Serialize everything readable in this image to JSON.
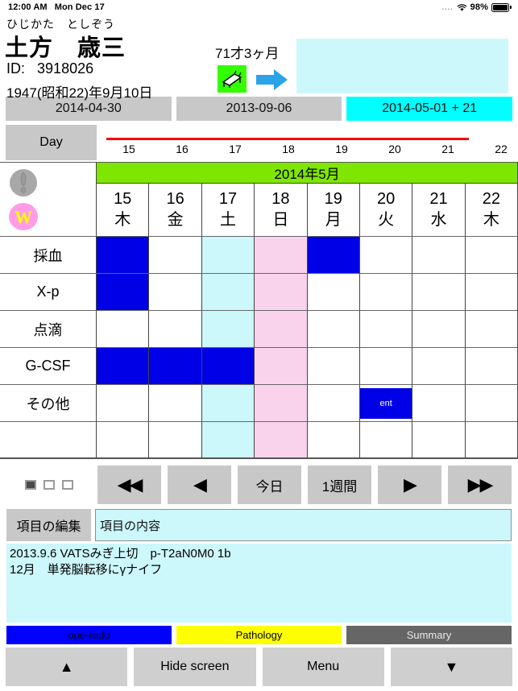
{
  "statusbar": {
    "time": "12:00 AM",
    "date": "Mon Dec 17",
    "dots": "....",
    "battery": "98%",
    "wifi_icon": "wifi-icon",
    "battery_icon": "battery-icon"
  },
  "patient": {
    "kana": "ひじかた　としぞう",
    "name": "土方　歳三",
    "id_label": "ID:",
    "id_value": "3918026",
    "birthdate": "1947(昭和22)年9月10日",
    "age": "71才3ヶ月",
    "bed_icon": "bed-icon",
    "arrow_icon": "arrow-right-icon",
    "memo": ""
  },
  "date_buttons": [
    {
      "label": "2014-04-30",
      "active": false
    },
    {
      "label": "2013-09-06",
      "active": false
    },
    {
      "label": "2014-05-01 + 21",
      "active": true
    }
  ],
  "ruler": {
    "day_button": "Day",
    "ticks": [
      "15",
      "16",
      "17",
      "18",
      "19",
      "20",
      "21",
      "22"
    ],
    "flag_icon": "flag-icon"
  },
  "calendar": {
    "month_label": "2014年5月",
    "status_icon_1": "warning-circle-icon",
    "status_icon_2": "w-badge-icon",
    "columns": [
      {
        "day": "15",
        "weekday": "木",
        "type": "weekday"
      },
      {
        "day": "16",
        "weekday": "金",
        "type": "weekday"
      },
      {
        "day": "17",
        "weekday": "土",
        "type": "sat"
      },
      {
        "day": "18",
        "weekday": "日",
        "type": "sun"
      },
      {
        "day": "19",
        "weekday": "月",
        "type": "weekday"
      },
      {
        "day": "20",
        "weekday": "火",
        "type": "weekday"
      },
      {
        "day": "21",
        "weekday": "水",
        "type": "weekday"
      },
      {
        "day": "22",
        "weekday": "木",
        "type": "weekday"
      }
    ],
    "rows": [
      {
        "label": "採血",
        "cells": [
          {
            "mark": true
          },
          {},
          {},
          {},
          {
            "mark": true
          },
          {},
          {},
          {}
        ]
      },
      {
        "label": "X-p",
        "cells": [
          {
            "mark": true
          },
          {},
          {},
          {},
          {},
          {},
          {},
          {}
        ]
      },
      {
        "label": "点滴",
        "cells": [
          {},
          {},
          {},
          {},
          {},
          {},
          {},
          {}
        ]
      },
      {
        "label": "G-CSF",
        "cells": [
          {
            "mark": true
          },
          {
            "mark": true
          },
          {
            "mark": true
          },
          {},
          {},
          {},
          {},
          {}
        ]
      },
      {
        "label": "その他",
        "cells": [
          {},
          {},
          {},
          {},
          {},
          {
            "chip": "ent"
          },
          {},
          {}
        ]
      },
      {
        "label": "",
        "cells": [
          {},
          {},
          {},
          {},
          {},
          {},
          {},
          {}
        ]
      }
    ]
  },
  "nav": {
    "indicators": [
      true,
      false,
      false
    ],
    "buttons": [
      {
        "name": "rewind",
        "glyph": "◀◀"
      },
      {
        "name": "prev",
        "glyph": "◀"
      },
      {
        "name": "today",
        "glyph": "今日"
      },
      {
        "name": "one-week",
        "glyph": "1週間"
      },
      {
        "name": "next",
        "glyph": "▶"
      },
      {
        "name": "fast-forward",
        "glyph": "▶▶"
      }
    ]
  },
  "item_edit": {
    "button_label": "項目の編集",
    "field_placeholder": "項目の内容",
    "field_value": ""
  },
  "notes": {
    "text": "2013.9.6 VATSみぎ上切　p-T2aN0M0 1b\n12月　単発脳転移にγナイフ"
  },
  "tags": [
    {
      "label": "ope-redo",
      "color": "#0000ff"
    },
    {
      "label": "Pathology",
      "color": "#ffff00"
    },
    {
      "label": "Summary",
      "color": "#666666"
    }
  ],
  "bottom": [
    {
      "name": "scroll-up",
      "label": "▲"
    },
    {
      "name": "hide-screen",
      "label": "Hide screen"
    },
    {
      "name": "menu",
      "label": "Menu"
    },
    {
      "name": "scroll-down",
      "label": "▼"
    }
  ]
}
